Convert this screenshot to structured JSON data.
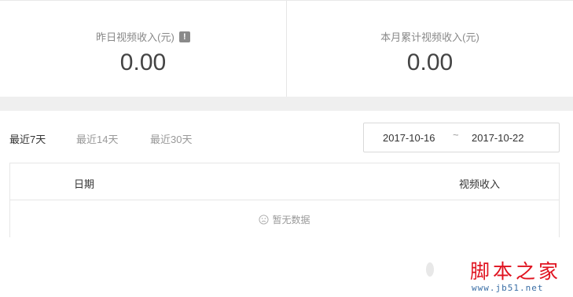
{
  "stats": {
    "yesterday": {
      "label": "昨日视频收入(元)",
      "info_icon": "!",
      "value": "0.00"
    },
    "month": {
      "label": "本月累计视频收入(元)",
      "value": "0.00"
    }
  },
  "range_tabs": [
    {
      "label": "最近7天",
      "active": true
    },
    {
      "label": "最近14天",
      "active": false
    },
    {
      "label": "最近30天",
      "active": false
    }
  ],
  "date_range": {
    "start": "2017-10-16",
    "separator": "~",
    "end": "2017-10-22"
  },
  "table": {
    "columns": [
      "日期",
      "视频收入"
    ],
    "empty_text": "暂无数据"
  },
  "watermark": {
    "title": "脚本之家",
    "url": "www.jb51.net"
  },
  "colors": {
    "band": "#efefef",
    "watermark_red": "#e0121f",
    "watermark_blue": "#3a6ea5"
  }
}
